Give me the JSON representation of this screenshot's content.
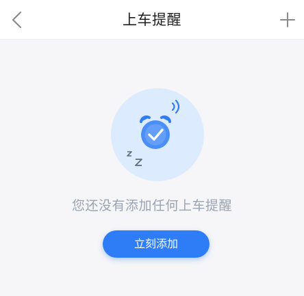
{
  "nav": {
    "title": "上车提醒",
    "back_icon": "chevron-left-icon",
    "add_icon": "plus-icon"
  },
  "empty_state": {
    "illustration_icon": "alarm-clock-sleep-icon",
    "message": "您还没有添加任何上车提醒",
    "button_label": "立刻添加"
  },
  "colors": {
    "accent": "#2f7df6",
    "illustration_bg": "#dcebfd",
    "muted_text": "#9aa3b2"
  }
}
